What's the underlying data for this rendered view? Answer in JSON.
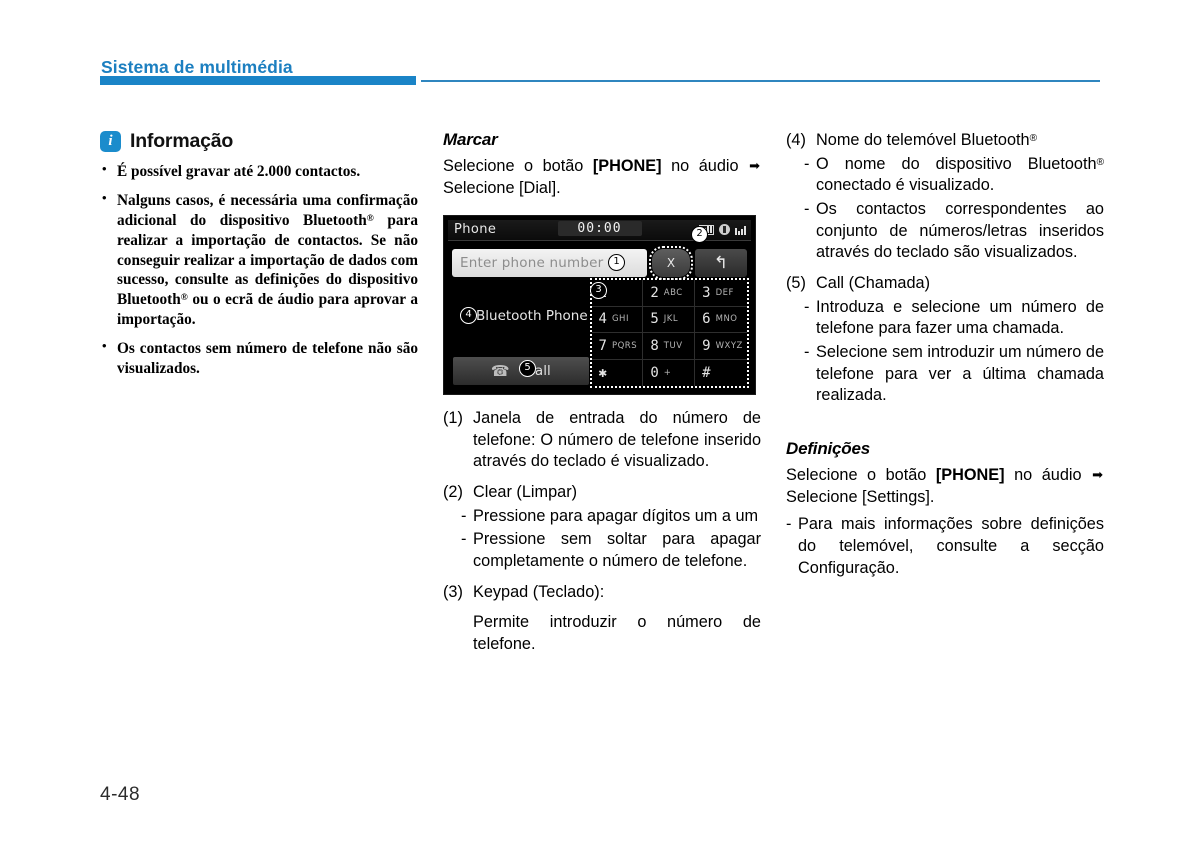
{
  "header": {
    "title": "Sistema de multimédia",
    "accent_color": "#1a84c7"
  },
  "page_number": "4-48",
  "left_column": {
    "info_box": {
      "icon": "info-icon",
      "title": "Informação",
      "items": [
        "É possível gravar até 2.000 contactos.",
        "Nalguns casos, é necessária uma confirmação adicional do dispositivo Bluetooth® para realizar a importação de contactos. Se não conseguir realizar a importação de dados com sucesso, consulte as definições do dispositivo Bluetooth® ou o ecrã de áudio para aprovar a importação.",
        "Os contactos sem número de telefone não são visualizados."
      ]
    }
  },
  "middle_column": {
    "section_title": "Marcar",
    "intro_part1": "Selecione o botão ",
    "intro_bold": "[PHONE]",
    "intro_part2": " no áudio ",
    "intro_arrow": "➡",
    "intro_part3": " Selecione [Dial].",
    "numbered_items": [
      {
        "marker": "(1)",
        "text": "Janela de entrada do número de telefone: O número de telefone inserido através do teclado é visualizado."
      },
      {
        "marker": "(2)",
        "text": "Clear (Limpar)",
        "subitems": [
          {
            "marker": "-",
            "text": "Pressione para apagar dígitos um a um"
          },
          {
            "marker": "-",
            "text": "Pressione sem soltar para apagar completamente o número de telefone."
          }
        ]
      },
      {
        "marker": "(3)",
        "text": "Keypad (Teclado):",
        "plain": "Permite introduzir o número de telefone."
      }
    ]
  },
  "right_column": {
    "numbered_items": [
      {
        "marker": "(4)",
        "text": "Nome do telemóvel Bluetooth®",
        "subitems": [
          {
            "marker": "-",
            "text": "O nome do dispositivo Bluetooth® conectado é visualizado."
          },
          {
            "marker": "-",
            "text": "Os contactos correspondentes ao conjunto de números/letras inseridos através do teclado são visualizados."
          }
        ]
      },
      {
        "marker": "(5)",
        "text": "Call (Chamada)",
        "subitems": [
          {
            "marker": "-",
            "text": "Introduza e selecione um número de telefone para fazer uma chamada."
          },
          {
            "marker": "-",
            "text": "Selecione sem introduzir um número de telefone para ver a última chamada realizada."
          }
        ]
      }
    ],
    "settings_section": {
      "title": "Definições",
      "intro_part1": "Selecione o botão ",
      "intro_bold": "[PHONE]",
      "intro_part2": " no áudio ",
      "intro_arrow": "➡",
      "intro_part3": " Selecione [Settings].",
      "subitem_marker": "-",
      "subitem_text": "Para mais informações sobre definições do telemóvel, consulte a secção Configuração."
    }
  },
  "dialer": {
    "app_title": "Phone",
    "clock": "00:00",
    "status_icons": [
      "signal-bars-icon",
      "bluetooth-audio-icon",
      "phone-antenna-icon"
    ],
    "input_placeholder": "Enter phone number",
    "clear_label": "X",
    "back_label": "↰",
    "bluetooth_device": "Bluetooth Phone",
    "call_label": "Call",
    "call_icon": "phone-handset-icon",
    "keys": [
      {
        "main": "1",
        "sub": ""
      },
      {
        "main": "2",
        "sub": "ABC"
      },
      {
        "main": "3",
        "sub": "DEF"
      },
      {
        "main": "4",
        "sub": "GHI"
      },
      {
        "main": "5",
        "sub": "JKL"
      },
      {
        "main": "6",
        "sub": "MNO"
      },
      {
        "main": "7",
        "sub": "PQRS"
      },
      {
        "main": "8",
        "sub": "TUV"
      },
      {
        "main": "9",
        "sub": "WXYZ"
      },
      {
        "main": "✱",
        "sub": ""
      },
      {
        "main": "0",
        "sub": "+"
      },
      {
        "main": "#",
        "sub": ""
      }
    ],
    "callouts": [
      "1",
      "2",
      "3",
      "4",
      "5"
    ]
  }
}
